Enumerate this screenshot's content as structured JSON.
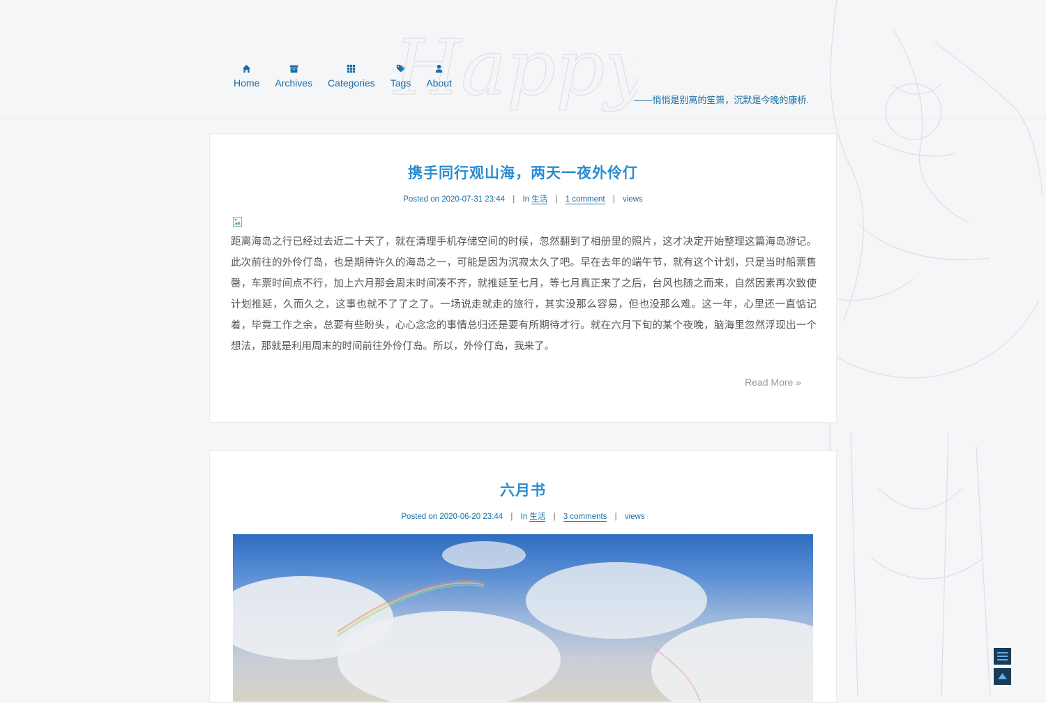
{
  "nav": {
    "items": [
      {
        "label": "Home",
        "icon": "home-icon"
      },
      {
        "label": "Archives",
        "icon": "archive-icon"
      },
      {
        "label": "Categories",
        "icon": "th-icon"
      },
      {
        "label": "Tags",
        "icon": "tags-icon"
      },
      {
        "label": "About",
        "icon": "user-icon"
      }
    ]
  },
  "header": {
    "slogan": "——悄悄是别离的笙箫，沉默是今晚的康桥.",
    "decor_text": "Happy"
  },
  "posts": [
    {
      "title": "携手同行观山海，两天一夜外伶仃",
      "posted_label": "Posted on",
      "date": "2020-07-31 23:44",
      "in_label": "In",
      "category": "生活",
      "comments": "1 comment",
      "views": "views",
      "excerpt": "距离海岛之行已经过去近二十天了，就在清理手机存储空间的时候，忽然翻到了相册里的照片，这才决定开始整理这篇海岛游记。此次前往的外伶仃岛，也是期待许久的海岛之一，可能是因为沉寂太久了吧。早在去年的端午节，就有这个计划，只是当时船票售罄，车票时间点不行，加上六月那会周末时间凑不齐，就推延至七月，等七月真正来了之后，台风也随之而来，自然因素再次致使计划推延，久而久之，这事也就不了了之了。一场说走就走的旅行，其实没那么容易，但也没那么难。这一年，心里还一直惦记着，毕竟工作之余，总要有些盼头，心心念念的事情总归还是要有所期待才行。就在六月下旬的某个夜晚，脑海里忽然浮现出一个想法，那就是利用周末的时间前往外伶仃岛。所以，外伶仃岛，我来了。",
      "read_more": "Read More »"
    },
    {
      "title": "六月书",
      "posted_label": "Posted on",
      "date": "2020-06-20 23:44",
      "in_label": "In",
      "category": "生活",
      "comments": "3 comments",
      "views": "views"
    }
  ],
  "colors": {
    "accent": "#2a8ccf",
    "link": "#1a6da3",
    "fab": "#1a3a55"
  }
}
